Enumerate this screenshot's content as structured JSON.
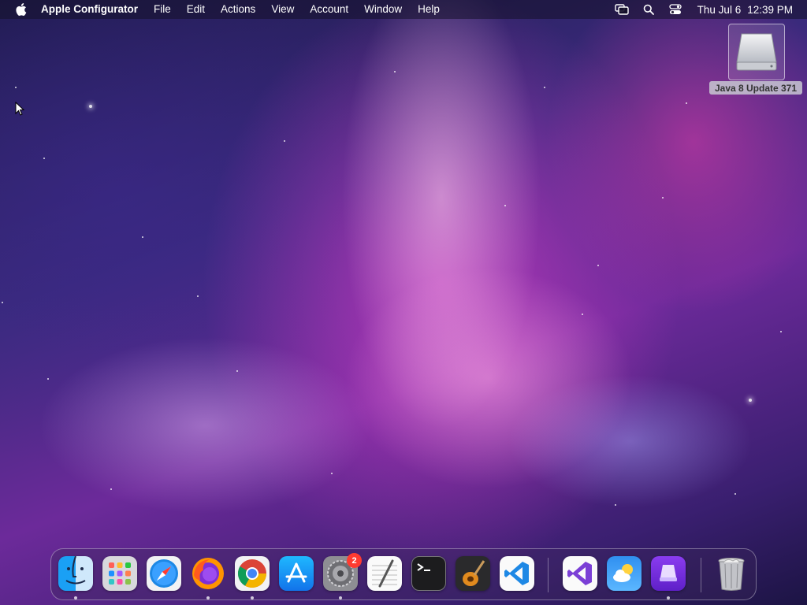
{
  "menubar": {
    "apple_icon": "apple-icon",
    "app_name": "Apple Configurator",
    "menus": [
      "File",
      "Edit",
      "Actions",
      "View",
      "Account",
      "Window",
      "Help"
    ],
    "status_icons": [
      "screen-mirroring-icon",
      "spotlight-search-icon",
      "control-center-icon"
    ],
    "clock": {
      "date": "Thu Jul 6",
      "time": "12:39 PM"
    }
  },
  "desktop": {
    "disk": {
      "label": "Java 8 Update 371",
      "icon": "external-disk-icon"
    }
  },
  "dock": {
    "items": [
      {
        "name": "Finder",
        "icon": "finder-icon",
        "running": true
      },
      {
        "name": "Launchpad",
        "icon": "launchpad-icon",
        "running": false
      },
      {
        "name": "Safari",
        "icon": "safari-icon",
        "running": false
      },
      {
        "name": "Firefox",
        "icon": "firefox-icon",
        "running": true
      },
      {
        "name": "Google Chrome",
        "icon": "chrome-icon",
        "running": true
      },
      {
        "name": "App Store",
        "icon": "app-store-icon",
        "running": false
      },
      {
        "name": "System Settings",
        "icon": "system-settings-icon",
        "running": true,
        "badge": "2"
      },
      {
        "name": "TextEdit",
        "icon": "textedit-icon",
        "running": false
      },
      {
        "name": "Terminal",
        "icon": "terminal-icon",
        "running": false
      },
      {
        "name": "GarageBand",
        "icon": "garageband-icon",
        "running": false
      },
      {
        "name": "Visual Studio Code",
        "icon": "vscode-icon",
        "running": false
      },
      {
        "name": "Visual Studio",
        "icon": "visual-studio-icon",
        "running": false
      },
      {
        "name": "Weather",
        "icon": "weather-icon",
        "running": false
      },
      {
        "name": "Apple Configurator",
        "icon": "apple-configurator-icon",
        "running": true
      },
      {
        "name": "Trash",
        "icon": "trash-icon",
        "running": false
      }
    ]
  },
  "colors": {
    "badge": "#ff3b30",
    "menubar_text": "#ffffff",
    "disk_label_bg": "#c8c8d2"
  }
}
